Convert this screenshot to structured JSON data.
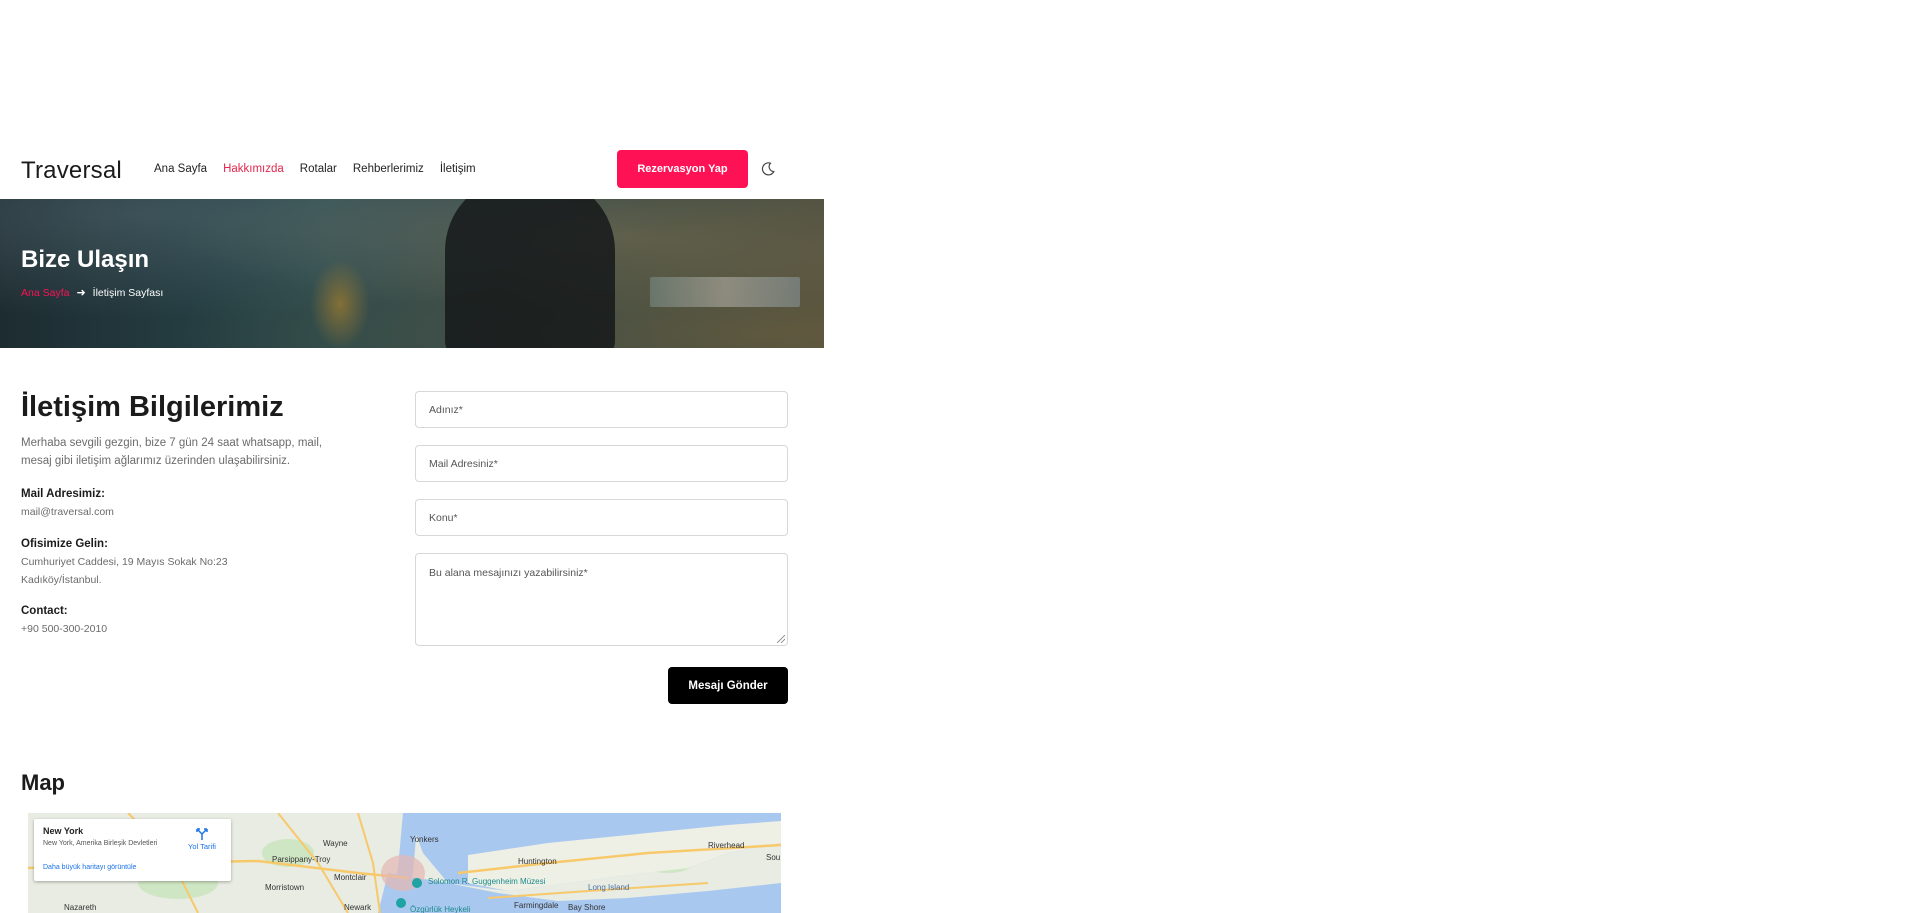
{
  "header": {
    "logo": "Traversal",
    "nav": [
      {
        "label": "Ana Sayfa",
        "active": false
      },
      {
        "label": "Hakkımızda",
        "active": true
      },
      {
        "label": "Rotalar",
        "active": false
      },
      {
        "label": "Rehberlerimiz",
        "active": false
      },
      {
        "label": "İletişim",
        "active": false
      }
    ],
    "reserve_button": "Rezervasyon Yap",
    "theme_icon": "moon-icon"
  },
  "hero": {
    "title": "Bize Ulaşın",
    "breadcrumb": {
      "home": "Ana Sayfa",
      "separator_icon": "arrow-right-icon",
      "current": "İletişim Sayfası"
    }
  },
  "contact": {
    "title": "İletişim Bilgilerimiz",
    "intro": "Merhaba sevgili gezgin, bize 7 gün 24 saat whatsapp, mail, mesaj gibi iletişim ağlarımız üzerinden ulaşabilirsiniz.",
    "mail_label": "Mail Adresimiz:",
    "mail_value": "mail@traversal.com",
    "office_label": "Ofisimize Gelin:",
    "office_line1": "Cumhuriyet Caddesi, 19 Mayıs Sokak No:23",
    "office_line2": "Kadıköy/İstanbul.",
    "phone_label": "Contact:",
    "phone_value": "+90 500-300-2010"
  },
  "form": {
    "name_placeholder": "Adınız*",
    "email_placeholder": "Mail Adresiniz*",
    "subject_placeholder": "Konu*",
    "message_placeholder": "Bu alana mesajınızı yazabilirsiniz*",
    "submit": "Mesajı Gönder"
  },
  "map": {
    "title": "Map",
    "card_title": "New York",
    "card_subtitle": "New York, Amerika Birleşik Devletleri",
    "card_link": "Daha büyük haritayı görüntüle",
    "directions": "Yol Tarifi",
    "labels": [
      "Yonkers",
      "Wayne",
      "Parsippany-Troy",
      "Montclair",
      "Morristown",
      "Nazareth",
      "Newark",
      "Solomon R. Guggenheim Müzesi",
      "Özgürlük Heykeli",
      "Huntington",
      "Long Island",
      "Farmingdale",
      "Bay Shore",
      "Riverhead",
      "Sou"
    ],
    "colors": {
      "water": "#a9c8f0",
      "land": "#e8ece3",
      "park": "#cfe6c4",
      "highway": "#f7c96b"
    }
  }
}
